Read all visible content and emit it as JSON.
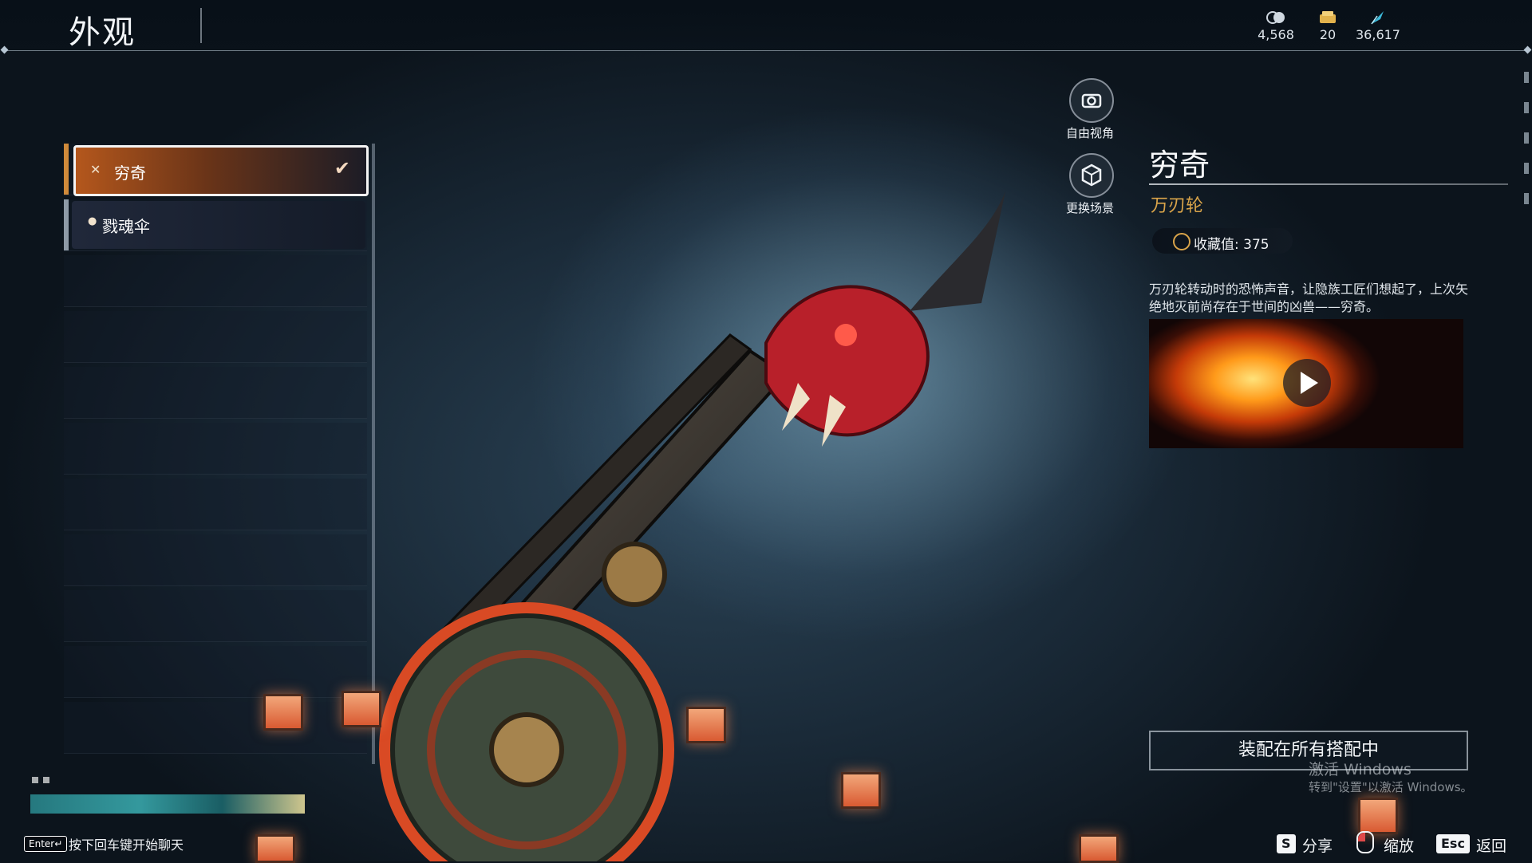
{
  "header": {
    "title": "外观",
    "currencies": [
      {
        "icon": "coin-stack-icon",
        "value": "4,568"
      },
      {
        "icon": "ticket-icon",
        "value": "20"
      },
      {
        "icon": "feather-icon",
        "value": "36,617"
      }
    ]
  },
  "list": {
    "items": [
      {
        "label": "穷奇",
        "icon": "cross-icon",
        "selected": true
      },
      {
        "label": "戮魂伞",
        "icon": "drop-icon",
        "selected": false
      }
    ]
  },
  "camera": {
    "free_view_label": "自由视角",
    "change_scene_label": "更换场景"
  },
  "details": {
    "name": "穷奇",
    "type": "万刃轮",
    "collection_value": "收藏值: 375",
    "description": "万刃轮转动时的恐怖声音，让隐族工匠们想起了，上次矢绝地灭前尚存在于世间的凶兽——穷奇。",
    "equip_label": "装配在所有搭配中"
  },
  "watermark": {
    "line1": "激活 Windows",
    "line2": "转到\"设置\"以激活 Windows。"
  },
  "chat": {
    "enter_key": "Enter↵",
    "hint": "按下回车键开始聊天"
  },
  "controls": {
    "share_key": "S",
    "share_label": "分享",
    "zoom_label": "缩放",
    "back_key": "Esc",
    "back_label": "返回"
  },
  "colors": {
    "accent_orange": "#b4571c",
    "type_gold": "#d9a44a"
  }
}
